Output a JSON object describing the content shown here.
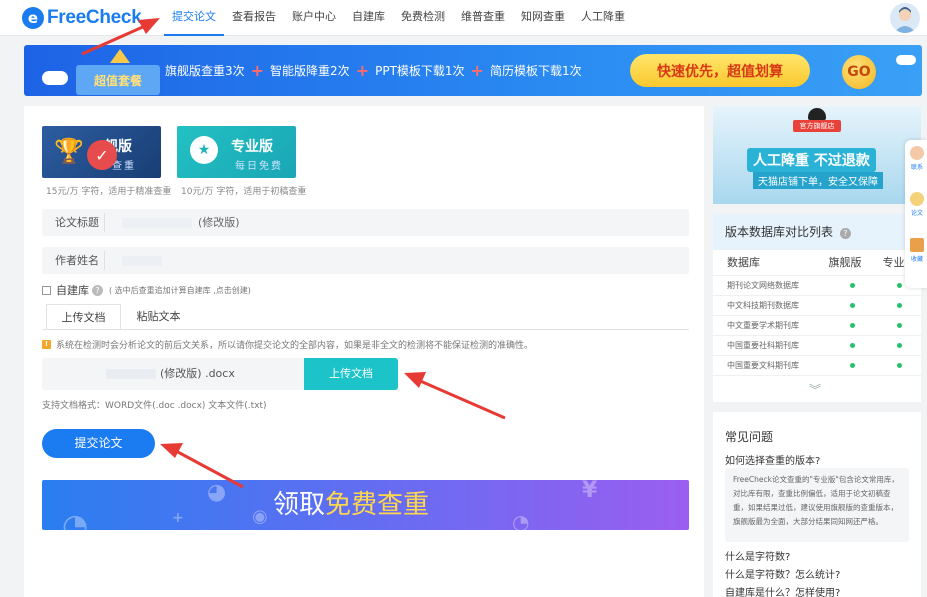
{
  "header": {
    "logo_text": "FreeCheck",
    "nav": [
      "提交论文",
      "查看报告",
      "账户中心",
      "自建库",
      "免费检测",
      "维普查重",
      "知网查重",
      "人工降重"
    ],
    "active_nav_index": 0
  },
  "promo": {
    "badge": "超值套餐",
    "items": [
      "旗舰版查重3次",
      "智能版降重2次",
      "PPT模板下载1次",
      "简历模板下载1次"
    ],
    "cta": "快速优先，超值划算",
    "go": "GO"
  },
  "versions": [
    {
      "title": "旗舰版",
      "visible_title": "舰版",
      "sub": "精准查重",
      "visible_sub": "查重",
      "desc": "15元/万 字符，适用于精准查重",
      "selected": true
    },
    {
      "title": "专业版",
      "sub": "每日免费",
      "desc": "10元/万 字符，适用于初稿查重",
      "selected": false
    }
  ],
  "form": {
    "title_label": "论文标题",
    "title_suffix": "(修改版)",
    "author_label": "作者姓名",
    "selfbuild_label": "自建库",
    "selfbuild_note": "( 选中后查重追加计算自建库 ,点击创建)",
    "tabs": [
      "上传文档",
      "粘贴文本"
    ],
    "warning": "系统在检测时会分析论文的前后文关系，所以请你提交论文的全部内容，如果是非全文的检测将不能保证检测的准确性。",
    "file_name": "(修改版) .docx",
    "upload_label": "上传文档",
    "formats": "支持文档格式：WORD文件(.doc .docx)  文本文件(.txt)",
    "submit_label": "提交论文"
  },
  "free_banner": {
    "prefix": "领取",
    "highlight": "免费查重"
  },
  "side_ad": {
    "shop_tag": "官方旗舰店",
    "title": "人工降重 不过退款",
    "sub": "天猫店铺下单，安全又保障"
  },
  "compare": {
    "title": "版本数据库对比列表",
    "columns": [
      "数据库",
      "旗舰版",
      "专业版"
    ],
    "rows": [
      {
        "name": "期刊论文网络数据库",
        "flagship": true,
        "pro": true
      },
      {
        "name": "中文科技期刊数据库",
        "flagship": true,
        "pro": true
      },
      {
        "name": "中文重要学术期刊库",
        "flagship": true,
        "pro": true
      },
      {
        "name": "中国重要社科期刊库",
        "flagship": true,
        "pro": true
      },
      {
        "name": "中国重要文科期刊库",
        "flagship": true,
        "pro": true
      }
    ]
  },
  "faq": {
    "title": "常见问题",
    "first_q": "如何选择查重的版本?",
    "first_a": "FreeCheck论文查重的\"专业版\"包含论文常用库，对比库有限，查重比例偏低，适用于论文初稿查重，如果结果过低，建议使用旗舰版的查重版本，旗舰版最为全面，大部分结果同知网还严格。",
    "others": [
      "什么是字符数?",
      "什么是字符数？怎么统计?",
      "自建库是什么？怎样使用?"
    ]
  },
  "float_bar": [
    "联系",
    "论文",
    "收藏"
  ]
}
